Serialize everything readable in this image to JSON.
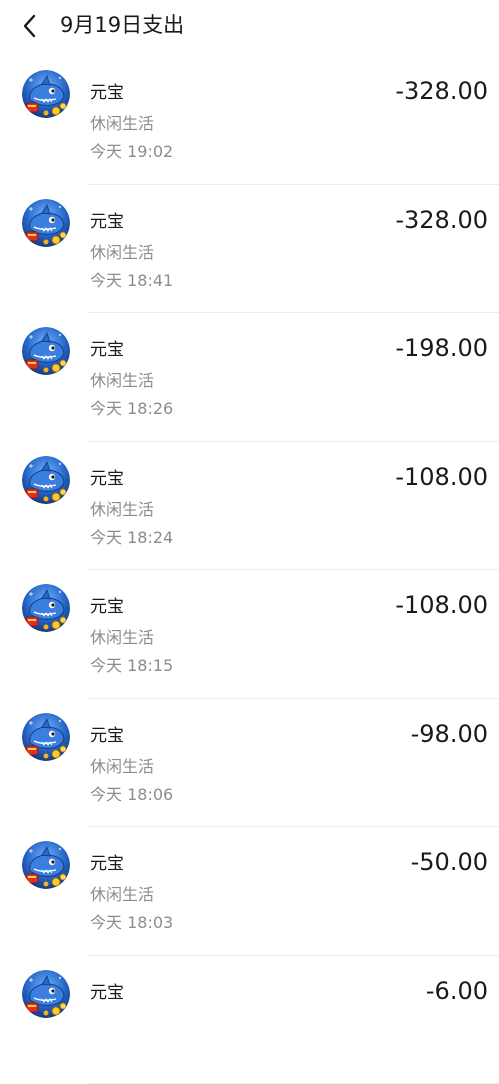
{
  "header": {
    "title": "9月19日支出",
    "back_icon": "chevron-left-icon"
  },
  "transactions": [
    {
      "name": "元宝",
      "category": "休闲生活",
      "time": "今天  19:02",
      "amount": "-328.00",
      "icon": "game-fish-avatar"
    },
    {
      "name": "元宝",
      "category": "休闲生活",
      "time": "今天  18:41",
      "amount": "-328.00",
      "icon": "game-fish-avatar"
    },
    {
      "name": "元宝",
      "category": "休闲生活",
      "time": "今天  18:26",
      "amount": "-198.00",
      "icon": "game-fish-avatar"
    },
    {
      "name": "元宝",
      "category": "休闲生活",
      "time": "今天  18:24",
      "amount": "-108.00",
      "icon": "game-fish-avatar"
    },
    {
      "name": "元宝",
      "category": "休闲生活",
      "time": "今天  18:15",
      "amount": "-108.00",
      "icon": "game-fish-avatar"
    },
    {
      "name": "元宝",
      "category": "休闲生活",
      "time": "今天  18:06",
      "amount": "-98.00",
      "icon": "game-fish-avatar"
    },
    {
      "name": "元宝",
      "category": "休闲生活",
      "time": "今天  18:03",
      "amount": "-50.00",
      "icon": "game-fish-avatar"
    },
    {
      "name": "元宝",
      "category": "",
      "time": "",
      "amount": "-6.00",
      "icon": "game-fish-avatar"
    }
  ],
  "colors": {
    "text_primary": "#1a1a1a",
    "text_secondary": "#8c8c8c",
    "divider": "#ececec",
    "avatar_bg": "#1f5fb8"
  }
}
